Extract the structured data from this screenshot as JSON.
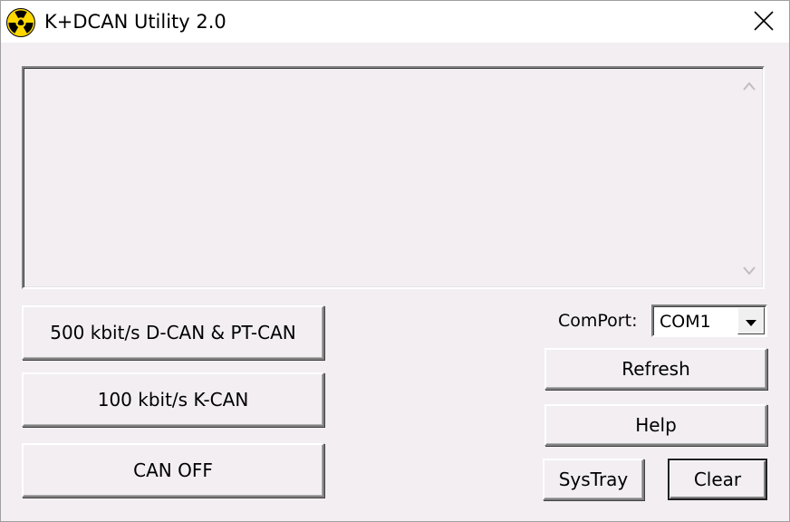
{
  "window": {
    "title": "K+DCAN Utility 2.0",
    "icon": "radiation-icon",
    "close_icon": "close-icon"
  },
  "log": {
    "text": ""
  },
  "buttons": {
    "dcan_ptcan": "500 kbit/s D-CAN & PT-CAN",
    "kcan": "100 kbit/s K-CAN",
    "can_off": "CAN OFF",
    "refresh": "Refresh",
    "help": "Help",
    "systray": "SysTray",
    "clear": "Clear"
  },
  "comport": {
    "label": "ComPort:",
    "selected": "COM1"
  },
  "colors": {
    "icon_yellow": "#ffd800",
    "icon_black": "#000000"
  }
}
